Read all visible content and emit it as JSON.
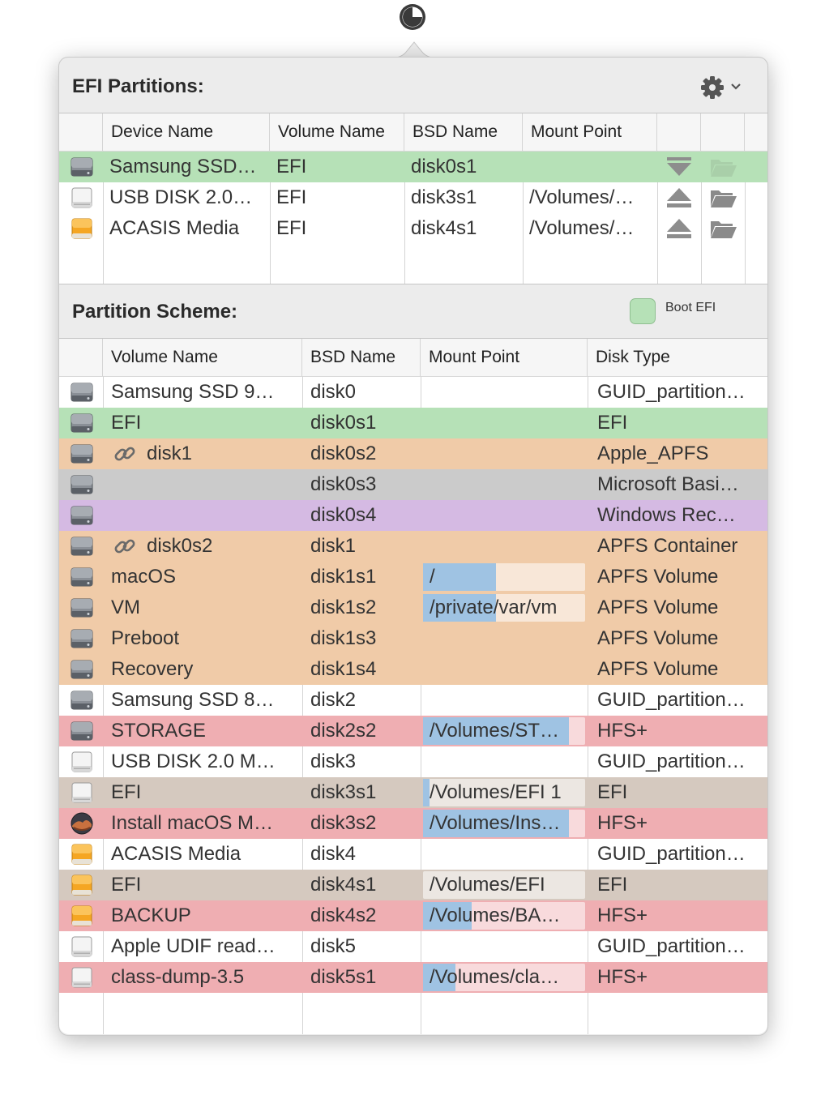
{
  "colors": {
    "efi_boot": "#b6e1b7",
    "apfs": "#f0cba8",
    "hfs": "#efaeb2",
    "efi_mounted": "#d5c9bf",
    "microsoft": "#cbcbcb",
    "windows_recovery": "#d5bae3",
    "usage_bar": "#9fc3e3"
  },
  "efi_section": {
    "title": "EFI Partitions:",
    "columns": [
      "Device Name",
      "Volume Name",
      "BSD Name",
      "Mount Point"
    ],
    "rows": [
      {
        "icon": "internal-disk-icon",
        "device_name": "Samsung SSD…",
        "volume_name": "EFI",
        "bsd_name": "disk0s1",
        "mount_point": "",
        "color": "efi_boot",
        "action": "unmount-icon",
        "folder_enabled": false
      },
      {
        "icon": "external-disk-icon",
        "device_name": "USB DISK 2.0…",
        "volume_name": "EFI",
        "bsd_name": "disk3s1",
        "mount_point": "/Volumes/…",
        "color": "",
        "action": "eject-icon",
        "folder_enabled": true
      },
      {
        "icon": "external-orange-disk-icon",
        "device_name": "ACASIS Media",
        "volume_name": "EFI",
        "bsd_name": "disk4s1",
        "mount_point": "/Volumes/…",
        "color": "",
        "action": "eject-icon",
        "folder_enabled": true
      }
    ]
  },
  "scheme_section": {
    "title": "Partition Scheme:",
    "legend_label": "Boot EFI",
    "columns": [
      "Volume Name",
      "BSD Name",
      "Mount Point",
      "Disk Type"
    ],
    "rows": [
      {
        "icon": "internal-disk-icon",
        "linked": false,
        "volume_name": "Samsung SSD 9…",
        "bsd_name": "disk0",
        "mount_point": "",
        "usage": 0,
        "disk_type": "GUID_partition…",
        "color": ""
      },
      {
        "icon": "internal-disk-icon",
        "linked": false,
        "volume_name": "EFI",
        "bsd_name": "disk0s1",
        "mount_point": "",
        "usage": 0,
        "disk_type": "EFI",
        "color": "efi_boot"
      },
      {
        "icon": "internal-disk-icon",
        "linked": true,
        "volume_name": "disk1",
        "bsd_name": "disk0s2",
        "mount_point": "",
        "usage": 0,
        "disk_type": "Apple_APFS",
        "color": "apfs"
      },
      {
        "icon": "internal-disk-icon",
        "linked": false,
        "volume_name": "",
        "bsd_name": "disk0s3",
        "mount_point": "",
        "usage": 0,
        "disk_type": "Microsoft Basi…",
        "color": "microsoft"
      },
      {
        "icon": "internal-disk-icon",
        "linked": false,
        "volume_name": "",
        "bsd_name": "disk0s4",
        "mount_point": "",
        "usage": 0,
        "disk_type": "Windows Rec…",
        "color": "windows_recovery"
      },
      {
        "icon": "internal-disk-icon",
        "linked": true,
        "volume_name": "disk0s2",
        "bsd_name": "disk1",
        "mount_point": "",
        "usage": 0,
        "disk_type": "APFS Container",
        "color": "apfs"
      },
      {
        "icon": "internal-disk-icon",
        "linked": false,
        "volume_name": "macOS",
        "bsd_name": "disk1s1",
        "mount_point": "/",
        "usage": 0.45,
        "disk_type": "APFS Volume",
        "color": "apfs"
      },
      {
        "icon": "internal-disk-icon",
        "linked": false,
        "volume_name": "VM",
        "bsd_name": "disk1s2",
        "mount_point": "/private/var/vm",
        "usage": 0.45,
        "disk_type": "APFS Volume",
        "color": "apfs"
      },
      {
        "icon": "internal-disk-icon",
        "linked": false,
        "volume_name": "Preboot",
        "bsd_name": "disk1s3",
        "mount_point": "",
        "usage": 0,
        "disk_type": "APFS Volume",
        "color": "apfs"
      },
      {
        "icon": "internal-disk-icon",
        "linked": false,
        "volume_name": "Recovery",
        "bsd_name": "disk1s4",
        "mount_point": "",
        "usage": 0,
        "disk_type": "APFS Volume",
        "color": "apfs"
      },
      {
        "icon": "internal-disk-icon",
        "linked": false,
        "volume_name": "Samsung SSD 8…",
        "bsd_name": "disk2",
        "mount_point": "",
        "usage": 0,
        "disk_type": "GUID_partition…",
        "color": ""
      },
      {
        "icon": "internal-disk-icon",
        "linked": false,
        "volume_name": "STORAGE",
        "bsd_name": "disk2s2",
        "mount_point": "/Volumes/ST…",
        "usage": 0.9,
        "disk_type": "HFS+",
        "color": "hfs"
      },
      {
        "icon": "external-disk-icon",
        "linked": false,
        "volume_name": "USB DISK 2.0 M…",
        "bsd_name": "disk3",
        "mount_point": "",
        "usage": 0,
        "disk_type": "GUID_partition…",
        "color": ""
      },
      {
        "icon": "external-disk-icon",
        "linked": false,
        "volume_name": "EFI",
        "bsd_name": "disk3s1",
        "mount_point": "/Volumes/EFI 1",
        "usage": 0.04,
        "disk_type": "EFI",
        "color": "efi_mounted"
      },
      {
        "icon": "installer-disk-icon",
        "linked": false,
        "volume_name": "Install macOS M…",
        "bsd_name": "disk3s2",
        "mount_point": "/Volumes/Ins…",
        "usage": 0.9,
        "disk_type": "HFS+",
        "color": "hfs"
      },
      {
        "icon": "external-orange-disk-icon",
        "linked": false,
        "volume_name": "ACASIS Media",
        "bsd_name": "disk4",
        "mount_point": "",
        "usage": 0,
        "disk_type": "GUID_partition…",
        "color": ""
      },
      {
        "icon": "external-orange-disk-icon",
        "linked": false,
        "volume_name": "EFI",
        "bsd_name": "disk4s1",
        "mount_point": "/Volumes/EFI",
        "usage": 0,
        "disk_type": "EFI",
        "color": "efi_mounted"
      },
      {
        "icon": "external-orange-disk-icon",
        "linked": false,
        "volume_name": "BACKUP",
        "bsd_name": "disk4s2",
        "mount_point": "/Volumes/BA…",
        "usage": 0.3,
        "disk_type": "HFS+",
        "color": "hfs"
      },
      {
        "icon": "external-disk-icon",
        "linked": false,
        "volume_name": "Apple UDIF read…",
        "bsd_name": "disk5",
        "mount_point": "",
        "usage": 0,
        "disk_type": "GUID_partition…",
        "color": ""
      },
      {
        "icon": "external-disk-icon",
        "linked": false,
        "volume_name": "class-dump-3.5",
        "bsd_name": "disk5s1",
        "mount_point": "/Volumes/cla…",
        "usage": 0.2,
        "disk_type": "HFS+",
        "color": "hfs"
      }
    ]
  }
}
